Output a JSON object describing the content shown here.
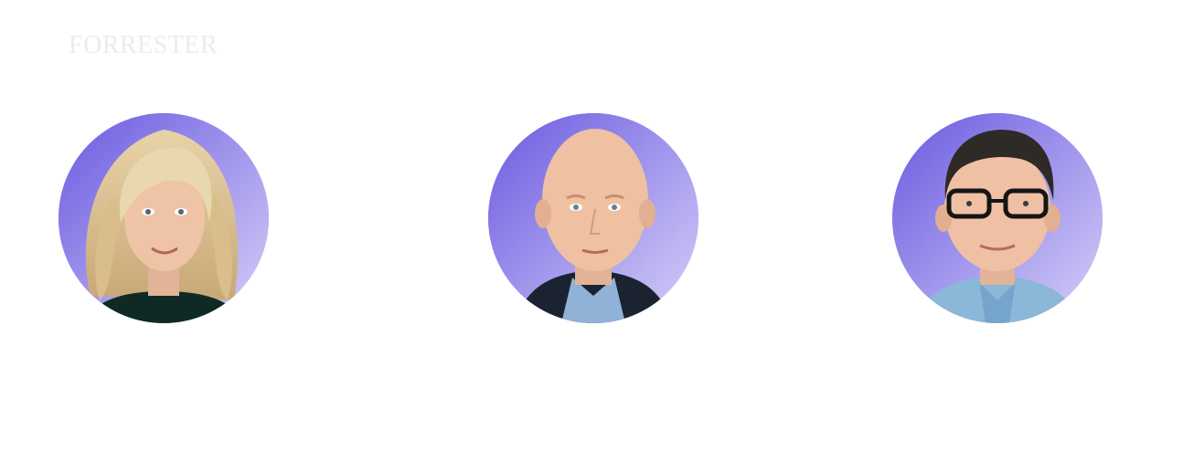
{
  "brand": {
    "logo_text": "Forrester"
  },
  "people": [
    {
      "icon": "portrait-woman-blonde-icon"
    },
    {
      "icon": "portrait-man-bald-suit-icon"
    },
    {
      "icon": "portrait-man-glasses-icon"
    }
  ],
  "colors": {
    "avatar_gradient_top": "#6f5fe3",
    "avatar_gradient_bottom": "#d4cdf7",
    "logo": "#ececec"
  }
}
